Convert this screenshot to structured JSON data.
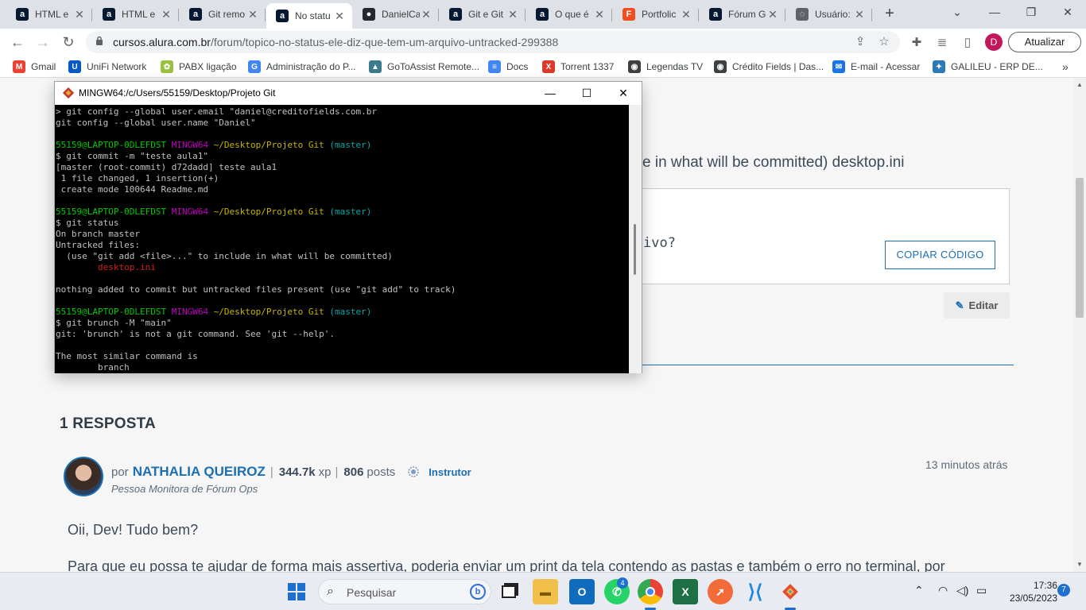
{
  "browser": {
    "tabs": [
      {
        "title": "HTML e",
        "icon": "alura-icon",
        "color": "#051933",
        "glyph": "a"
      },
      {
        "title": "HTML e",
        "icon": "alura-icon",
        "color": "#051933",
        "glyph": "a"
      },
      {
        "title": "Git remo",
        "icon": "alura-icon",
        "color": "#051933",
        "glyph": "a"
      },
      {
        "title": "No statu",
        "icon": "alura-icon",
        "color": "#051933",
        "glyph": "a",
        "active": true
      },
      {
        "title": "DanielCa",
        "icon": "github-icon",
        "color": "#24292e",
        "glyph": "●"
      },
      {
        "title": "Git e Git",
        "icon": "alura-icon",
        "color": "#051933",
        "glyph": "a"
      },
      {
        "title": "O que é",
        "icon": "alura-icon",
        "color": "#051933",
        "glyph": "a"
      },
      {
        "title": "Portfolic",
        "icon": "figma-icon",
        "color": "#f24e1e",
        "glyph": "F"
      },
      {
        "title": "Fórum G",
        "icon": "alura-icon",
        "color": "#051933",
        "glyph": "a"
      },
      {
        "title": "Usuário:",
        "icon": "loading-icon",
        "color": "#5f6368",
        "glyph": "◌"
      }
    ],
    "url_domain": "cursos.alura.com.br",
    "url_path": "/forum/topico-no-status-ele-diz-que-tem-um-arquivo-untracked-299388",
    "profile_initial": "D",
    "update_label": "Atualizar",
    "bookmarks": [
      {
        "label": "Gmail",
        "icon": "gmail-icon",
        "color": "#ea4335",
        "glyph": "M"
      },
      {
        "label": "UniFi Network",
        "icon": "unifi-icon",
        "color": "#0559c9",
        "glyph": "U"
      },
      {
        "label": "PABX ligação",
        "icon": "pabx-icon",
        "color": "#9bc23c",
        "glyph": "✿"
      },
      {
        "label": "Administração do P...",
        "icon": "google-icon",
        "color": "#4285f4",
        "glyph": "G"
      },
      {
        "label": "GoToAssist Remote...",
        "icon": "gotoassist-icon",
        "color": "#3a7c8c",
        "glyph": "▲"
      },
      {
        "label": "Docs",
        "icon": "docs-icon",
        "color": "#4285f4",
        "glyph": "≡"
      },
      {
        "label": "Torrent 1337",
        "icon": "torrent-icon",
        "color": "#e0392b",
        "glyph": "X"
      },
      {
        "label": "Legendas TV",
        "icon": "globe-icon",
        "color": "#3c4043",
        "glyph": "◉"
      },
      {
        "label": "Crédito Fields | Das...",
        "icon": "globe-icon",
        "color": "#3c4043",
        "glyph": "◉"
      },
      {
        "label": "E-mail - Acessar",
        "icon": "mail-icon",
        "color": "#1a73e8",
        "glyph": "✉"
      },
      {
        "label": "GALILEU - ERP DE...",
        "icon": "galileu-icon",
        "color": "#2a7ab8",
        "glyph": "✦"
      }
    ]
  },
  "forum": {
    "topic_fragment": "e in what will be committed) desktop.ini",
    "code_snippet": "ivo?",
    "copy_button": "COPIAR CÓDIGO",
    "edit_button": "Editar",
    "responses_title": "1 RESPOSTA",
    "reply": {
      "prefix": "por",
      "author": "NATHALIA QUEIROZ",
      "xp": "344.7k",
      "xp_label": "xp",
      "posts": "806",
      "posts_label": "posts",
      "badge": "Instrutor",
      "role": "Pessoa Monitora de Fórum Ops",
      "time": "13 minutos atrás",
      "greeting": "Oii, Dev! Tudo bem?",
      "paragraph": "Para que eu possa te ajudar de forma mais assertiva, poderia enviar um print da tela contendo as pastas e também o erro no terminal, por"
    }
  },
  "terminal_window": {
    "title": "MINGW64:/c/Users/55159/Desktop/Projeto Git",
    "lines": [
      [
        {
          "t": "> git config --global user.email \"daniel@creditofields.com.br"
        }
      ],
      [
        {
          "t": "git config --global user.name \"Daniel\""
        }
      ],
      [
        {
          "t": ""
        }
      ],
      [
        {
          "t": "55159@LAPTOP-0DLEFDST ",
          "c": "c-green"
        },
        {
          "t": "MINGW64 ",
          "c": "c-mag"
        },
        {
          "t": "~/Desktop/Projeto Git",
          "c": "c-yel"
        },
        {
          "t": " (master)",
          "c": "c-cyan"
        }
      ],
      [
        {
          "t": "$ git commit -m \"teste aula1\""
        }
      ],
      [
        {
          "t": "[master (root-commit) d72dadd] teste aula1"
        }
      ],
      [
        {
          "t": " 1 file changed, 1 insertion(+)"
        }
      ],
      [
        {
          "t": " create mode 100644 Readme.md"
        }
      ],
      [
        {
          "t": ""
        }
      ],
      [
        {
          "t": "55159@LAPTOP-0DLEFDST ",
          "c": "c-green"
        },
        {
          "t": "MINGW64 ",
          "c": "c-mag"
        },
        {
          "t": "~/Desktop/Projeto Git",
          "c": "c-yel"
        },
        {
          "t": " (master)",
          "c": "c-cyan"
        }
      ],
      [
        {
          "t": "$ git status"
        }
      ],
      [
        {
          "t": "On branch master"
        }
      ],
      [
        {
          "t": "Untracked files:"
        }
      ],
      [
        {
          "t": "  (use \"git add <file>...\" to include in what will be committed)"
        }
      ],
      [
        {
          "t": "        desktop.ini",
          "c": "c-red"
        }
      ],
      [
        {
          "t": ""
        }
      ],
      [
        {
          "t": "nothing added to commit but untracked files present (use \"git add\" to track)"
        }
      ],
      [
        {
          "t": ""
        }
      ],
      [
        {
          "t": "55159@LAPTOP-0DLEFDST ",
          "c": "c-green"
        },
        {
          "t": "MINGW64 ",
          "c": "c-mag"
        },
        {
          "t": "~/Desktop/Projeto Git",
          "c": "c-yel"
        },
        {
          "t": " (master)",
          "c": "c-cyan"
        }
      ],
      [
        {
          "t": "$ git brunch -M \"main\""
        }
      ],
      [
        {
          "t": "git: 'brunch' is not a git command. See 'git --help'."
        }
      ],
      [
        {
          "t": ""
        }
      ],
      [
        {
          "t": "The most similar command is"
        }
      ],
      [
        {
          "t": "        branch"
        }
      ]
    ]
  },
  "taskbar": {
    "search_label": "Pesquisar",
    "whatsapp_badge": "4",
    "time": "17:36",
    "date": "23/05/2023",
    "notifications": "7"
  }
}
